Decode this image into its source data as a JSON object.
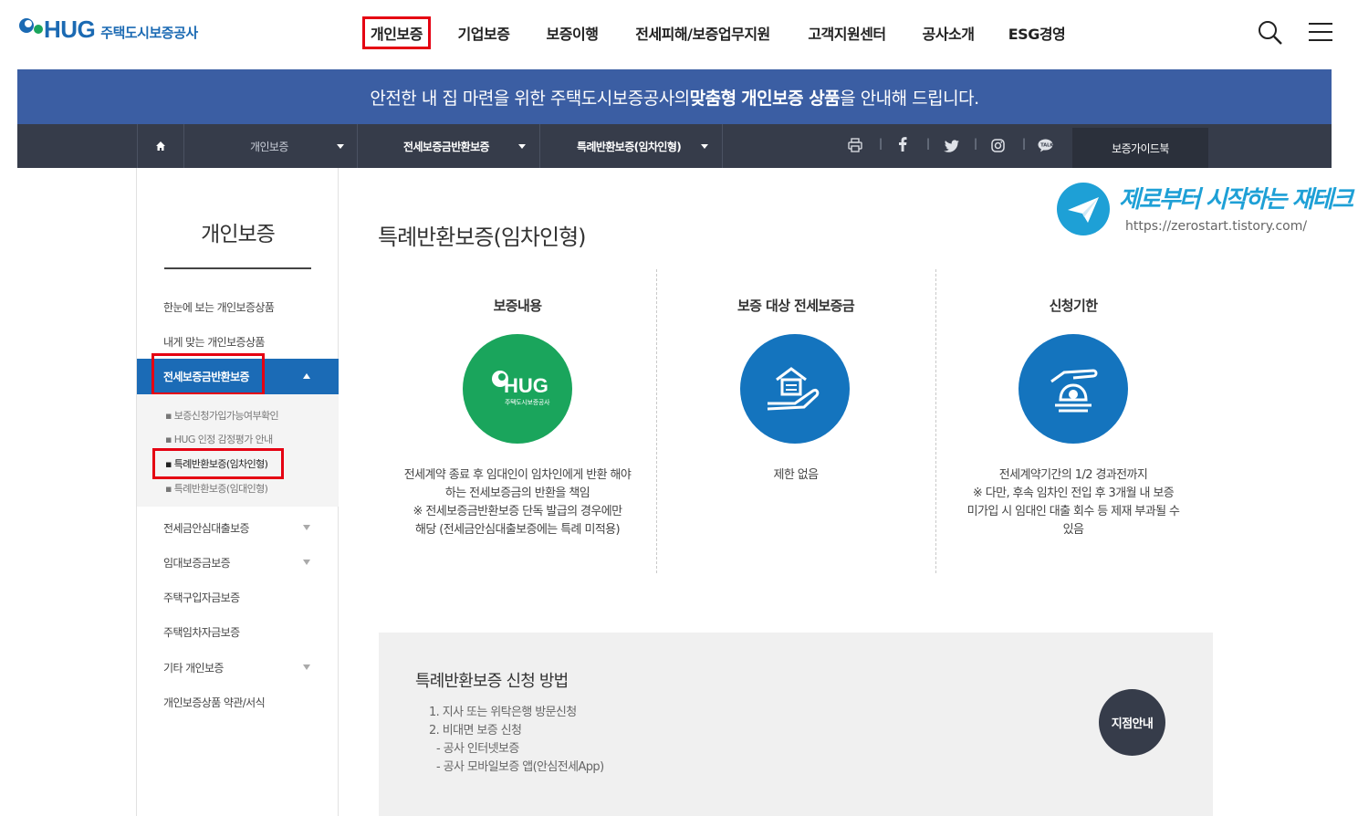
{
  "header": {
    "logo_text": "HUG",
    "logo_subtext": "주택도시보증공사",
    "nav": [
      "개인보증",
      "기업보증",
      "보증이행",
      "전세피해/보증업무지원",
      "고객지원센터",
      "공사소개",
      "ESG경영"
    ],
    "active_nav_index": 0
  },
  "banner": {
    "pre": "안전한 내 집 마련을 위한 주택도시보증공사의 ",
    "bold1": "맞춤형",
    "space": " ",
    "bold2": "개인보증 상품",
    "post": "을 안내해 드립니다."
  },
  "subbar": {
    "crumb1": "개인보증",
    "crumb2": "전세보증금반환보증",
    "crumb3": "특례반환보증(임차인형)",
    "guide": "보증가이드북",
    "icons": [
      "home-icon",
      "print-icon",
      "facebook-icon",
      "twitter-icon",
      "instagram-icon",
      "talk-icon"
    ]
  },
  "lnb": {
    "title": "개인보증",
    "items": [
      "한눈에 보는 개인보증상품",
      "내게 맞는 개인보증상품",
      "전세보증금반환보증",
      "전세금안심대출보증",
      "임대보증금보증",
      "주택구입자금보증",
      "주택임차자금보증",
      "기타 개인보증",
      "개인보증상품 약관/서식"
    ],
    "sub_items": [
      "보증신청가입가능여부확인",
      "HUG 인정 감정평가 안내",
      "특례반환보증(임차인형)",
      "특례반환보증(임대인형)"
    ]
  },
  "watermark": {
    "title": "제로부터 시작하는 재테크",
    "url": "https://zerostart.tistory.com/"
  },
  "content": {
    "title": "특례반환보증(임차인형)",
    "columns": [
      {
        "heading": "보증내용",
        "circle_logo": "HUG",
        "circle_sub": "주택도시보증공사",
        "lines": [
          "전세계약 종료 후 임대인이 임차인에게 반환 해야",
          "하는 전세보증금의 반환을 책임",
          "※ 전세보증금반환보증 단독 발급의 경우에만",
          "해당 (전세금안심대출보증에는 특례 미적용)"
        ]
      },
      {
        "heading": "보증 대상 전세보증금",
        "lines": [
          "제한 없음"
        ]
      },
      {
        "heading": "신청기한",
        "lines": [
          "전세계약기간의 1/2 경과전까지",
          "※ 다만, 후속 임차인 전입 후 3개월 내 보증",
          "미가입 시 임대인 대출 회수 등 제재 부과될 수",
          "있음"
        ]
      }
    ],
    "colors": {
      "green": "#1aa55c",
      "blue": "#1474be"
    }
  },
  "how": {
    "title": "특례반환보증 신청 방법",
    "lines": [
      "1. 지사 또는 위탁은행 방문신청",
      "2. 비대면 보증 신청",
      "- 공사 인터넷보증",
      "- 공사 모바일보증 앱(안심전세App)"
    ],
    "branch_button": "지점안내"
  }
}
